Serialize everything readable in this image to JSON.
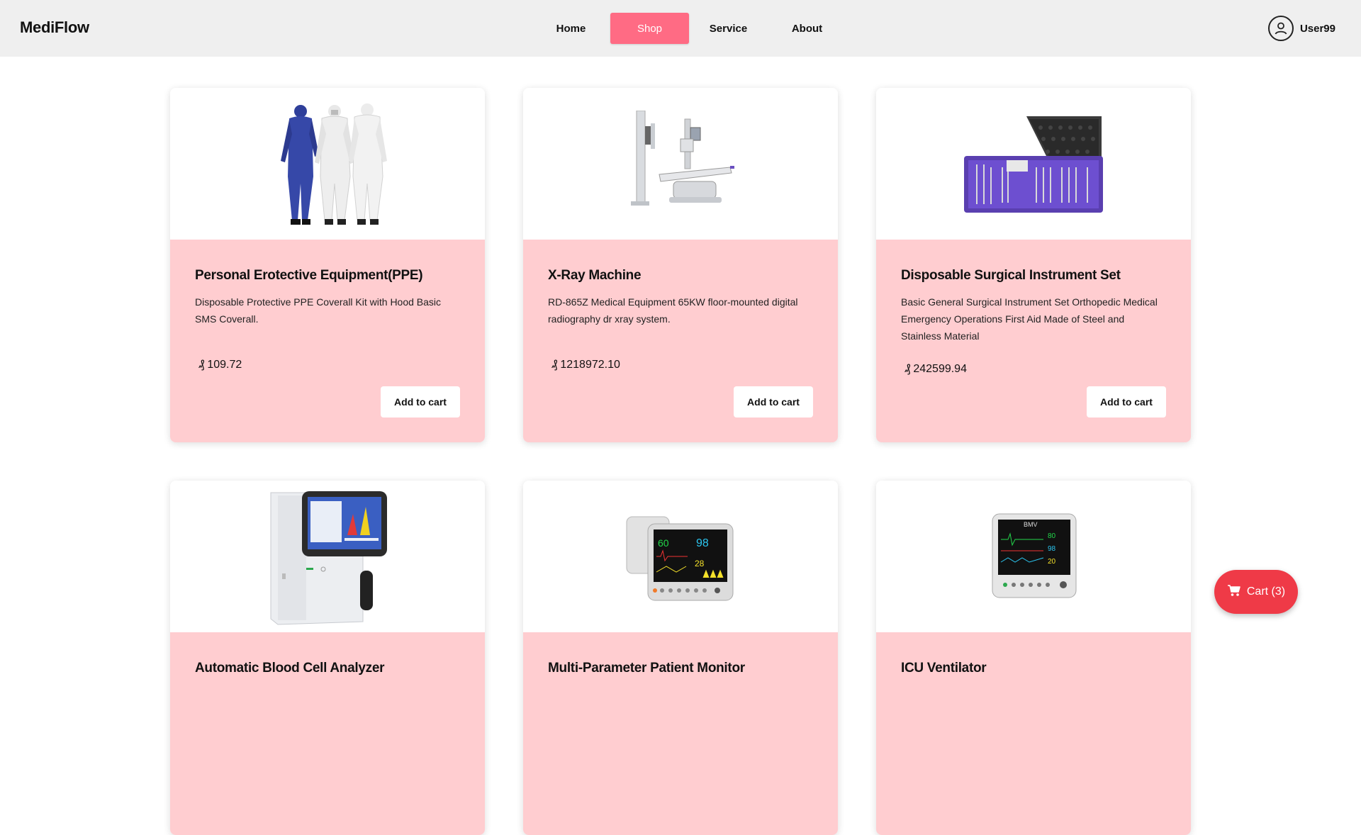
{
  "header": {
    "brand": "MediFlow",
    "nav": [
      {
        "label": "Home",
        "active": false
      },
      {
        "label": "Shop",
        "active": true
      },
      {
        "label": "Service",
        "active": false
      },
      {
        "label": "About",
        "active": false
      }
    ],
    "user": {
      "name": "User99",
      "icon": "user-icon"
    }
  },
  "currency_icon": "currency-icon",
  "products": [
    {
      "title": "Personal Erotective Equipment(PPE)",
      "description": "Disposable Protective PPE Coverall Kit with Hood Basic SMS Coverall.",
      "price": "109.72",
      "button": "Add to cart",
      "image": "ppe-coverall-image"
    },
    {
      "title": "X-Ray Machine",
      "description": "RD-865Z Medical Equipment 65KW floor-mounted digital radiography dr xray system.",
      "price": "1218972.10",
      "button": "Add to cart",
      "image": "xray-machine-image"
    },
    {
      "title": "Disposable Surgical Instrument Set",
      "description": "Basic General Surgical Instrument Set Orthopedic Medical Emergency Operations First Aid Made of Steel and Stainless Material",
      "price": "242599.94",
      "button": "Add to cart",
      "image": "surgical-kit-image"
    },
    {
      "title": "Automatic Blood Cell Analyzer",
      "description": "",
      "price": "",
      "button": "",
      "image": "blood-analyzer-image"
    },
    {
      "title": "Multi-Parameter Patient Monitor",
      "description": "",
      "price": "",
      "button": "",
      "image": "patient-monitor-image"
    },
    {
      "title": "ICU Ventilator",
      "description": "",
      "price": "",
      "button": "",
      "image": "icu-ventilator-image"
    }
  ],
  "cart": {
    "label": "Cart (3)",
    "icon": "cart-icon"
  },
  "colors": {
    "accent": "#ff6b84",
    "card_body": "#ffcdd0",
    "cart": "#ef3a47",
    "header_bg": "#efefef"
  }
}
